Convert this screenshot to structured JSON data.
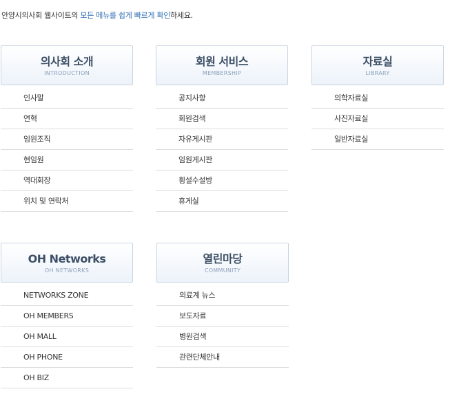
{
  "intro": {
    "prefix": "안양시의사회 웹사이트의 ",
    "highlight": "모든 메뉴를 쉽게 빠르게 확인",
    "suffix": "하세요."
  },
  "sections": [
    {
      "title": "의사회 소개",
      "subtitle": "INTRODUCTION",
      "items": [
        "인사말",
        "연혁",
        "임원조직",
        "현임원",
        "역대회장",
        "위치 및 연락처"
      ]
    },
    {
      "title": "회원 서비스",
      "subtitle": "MEMBERSHIP",
      "items": [
        "공지사항",
        "회원검색",
        "자유게시판",
        "임원게시판",
        "횡설수설방",
        "휴게실"
      ]
    },
    {
      "title": "자료실",
      "subtitle": "LIBRARY",
      "items": [
        "의학자료실",
        "사진자료실",
        "일반자료실"
      ]
    },
    {
      "title": "OH Networks",
      "subtitle": "OH NETWORKS",
      "items": [
        "NETWORKS ZONE",
        "OH MEMBERS",
        "OH MALL",
        "OH PHONE",
        "OH BIZ"
      ]
    },
    {
      "title": "열린마당",
      "subtitle": "COMMUNITY",
      "items": [
        "의료계 뉴스",
        "보도자료",
        "병원검색",
        "관련단체안내"
      ]
    }
  ]
}
